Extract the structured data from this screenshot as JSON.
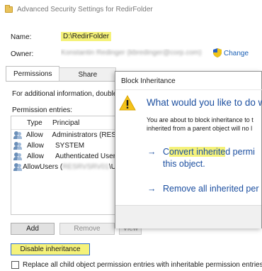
{
  "window": {
    "title": "Advanced Security Settings for RedirFolder",
    "icon": "folder-icon"
  },
  "name_row": {
    "label": "Name:",
    "value": "D:\\RedirFolder"
  },
  "owner_row": {
    "label": "Owner:",
    "value_obscured": "Konstantin Redinger (kbredinger@corp.com)",
    "change_link": "Change",
    "icon": "shield-icon"
  },
  "tabs": [
    {
      "label": "Permissions",
      "active": true
    },
    {
      "label": "Share",
      "active": false
    }
  ],
  "info_text": "For additional information, double",
  "entries": {
    "label": "Permission entries:",
    "columns": [
      "Type",
      "Principal"
    ],
    "rows": [
      {
        "type": "Allow",
        "principal": "Administrators (RES"
      },
      {
        "type": "Allow",
        "principal": "SYSTEM"
      },
      {
        "type": "Allow",
        "principal": "Authenticated User"
      },
      {
        "type": "Allow",
        "principal_prefix": "Users (",
        "principal_obscured": "RESRVSRV01",
        "principal_suffix": "\\U"
      }
    ]
  },
  "buttons": {
    "add": "Add",
    "remove": "Remove",
    "view": "View",
    "disable_inheritance": "Disable inheritance"
  },
  "checkbox": {
    "label": "Replace all child object permission entries with inheritable permission entries fr",
    "checked": false
  },
  "dialog": {
    "title": "Block Inheritance",
    "heading": "What would you like to do wi",
    "body_line1": "You are about to block inheritance to t",
    "body_line2": "inherited from a parent object will no l",
    "option1_pre": "C",
    "option1_highlight": "onvert inherite",
    "option1_post": "d permi",
    "option1_line2": "this object.",
    "option2": "Remove all inherited per",
    "icon": "warning-icon"
  },
  "colors": {
    "highlight": "#f5f27a",
    "link": "#1a5fb4",
    "dialog_text": "#1c4fa0"
  }
}
